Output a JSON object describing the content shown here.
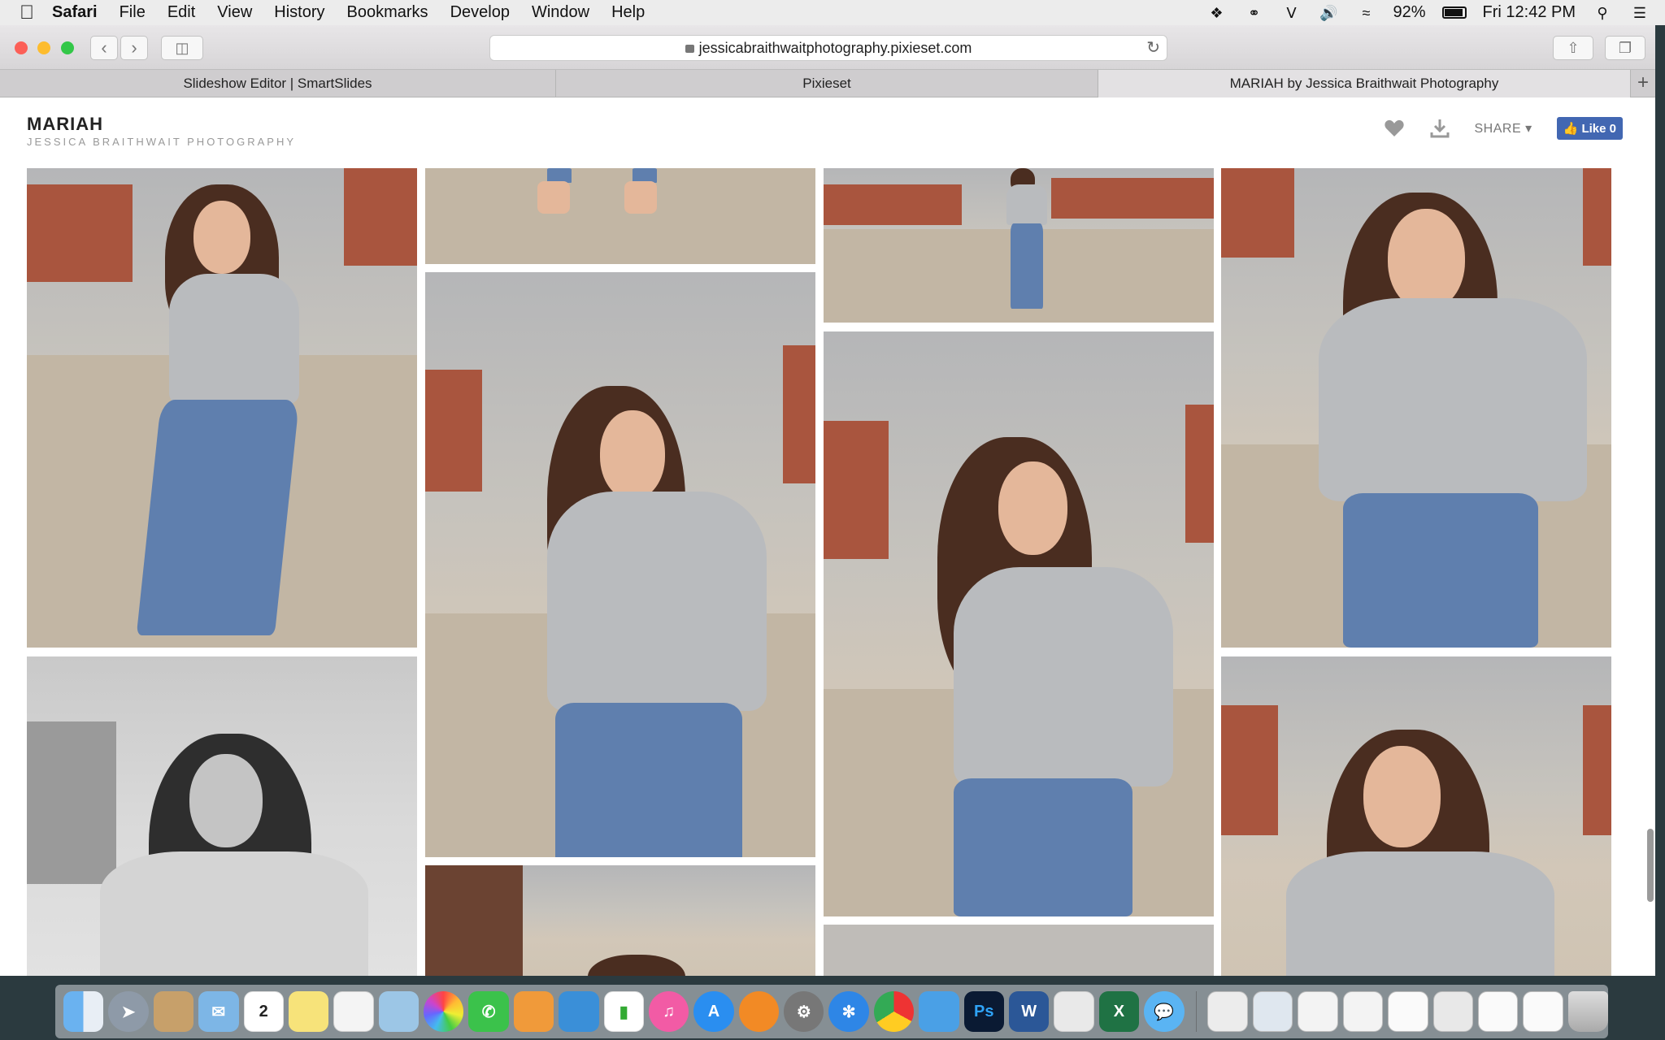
{
  "menubar": {
    "app_name": "Safari",
    "items": [
      "File",
      "Edit",
      "View",
      "History",
      "Bookmarks",
      "Develop",
      "Window",
      "Help"
    ],
    "battery": "92%",
    "clock": "Fri 12:42 PM"
  },
  "browser": {
    "url": "jessicabraithwaitphotography.pixieset.com",
    "tabs": [
      {
        "label": "Slideshow Editor | SmartSlides"
      },
      {
        "label": "Pixieset"
      },
      {
        "label": "MARIAH by Jessica Braithwait Photography"
      }
    ]
  },
  "gallery": {
    "title": "MARIAH",
    "subtitle": "JESSICA BRAITHWAIT PHOTOGRAPHY",
    "share_label": "SHARE",
    "like_label": "Like 0"
  },
  "dock": {
    "apps": [
      "finder",
      "launchpad",
      "contacts",
      "mail",
      "calendar",
      "notes",
      "reminders",
      "preview",
      "photos",
      "facetime",
      "pages",
      "keynote",
      "numbers",
      "itunes",
      "app-store",
      "ibooks",
      "system-preferences",
      "safari",
      "chrome",
      "maps",
      "photoshop",
      "word",
      "textedit",
      "excel",
      "messages"
    ],
    "calendar_day": "2",
    "photoshop_label": "Ps",
    "word_label": "W",
    "excel_label": "X"
  }
}
